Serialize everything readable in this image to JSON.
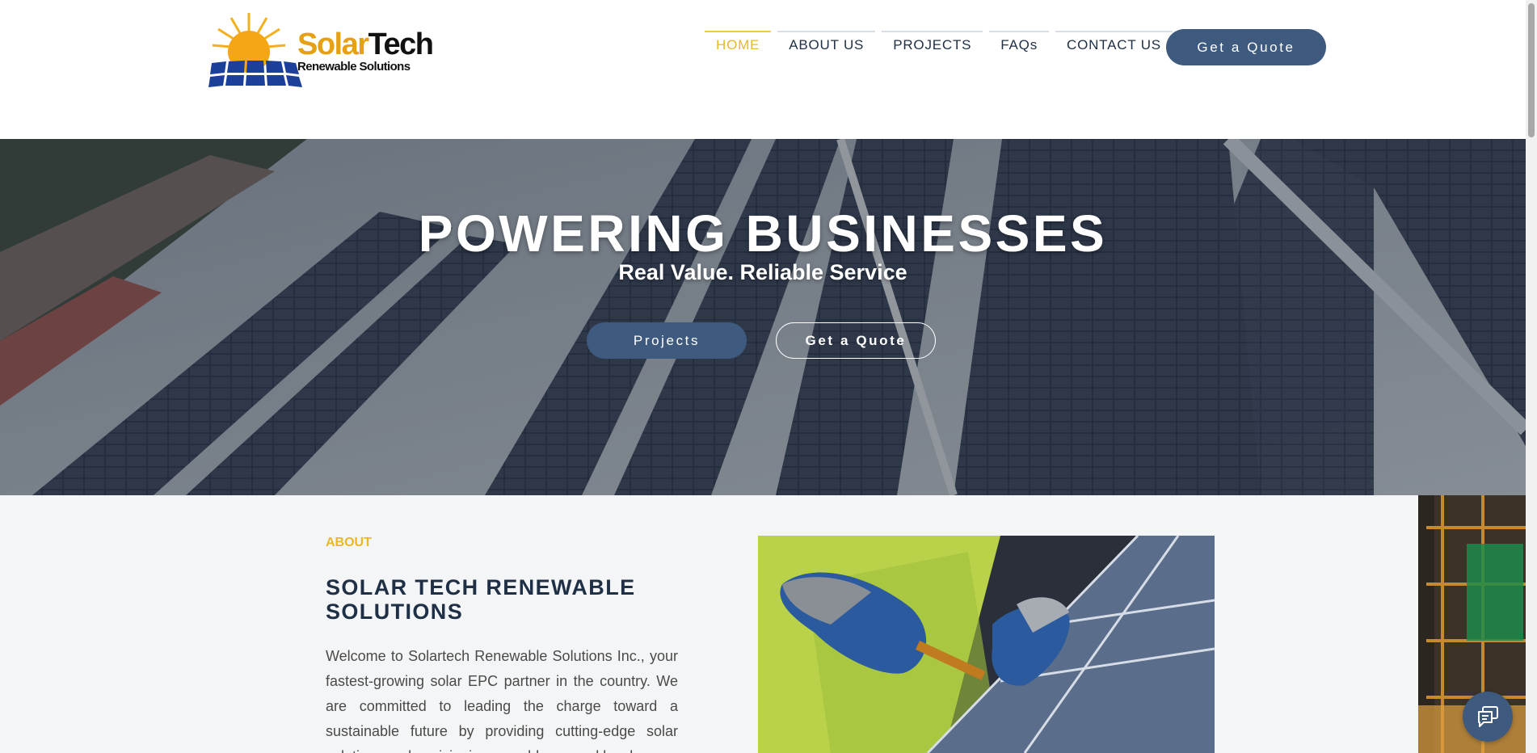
{
  "logo": {
    "word1": "Solar",
    "word2": "Tech",
    "tagline": "Renewable Solutions"
  },
  "nav": {
    "items": [
      {
        "label": "HOME",
        "active": true
      },
      {
        "label": "ABOUT US",
        "active": false
      },
      {
        "label": "PROJECTS",
        "active": false
      },
      {
        "label": "FAQs",
        "active": false
      },
      {
        "label": "CONTACT US",
        "active": false
      }
    ],
    "cta_label": "Get a Quote"
  },
  "hero": {
    "title": "POWERING BUSINESSES",
    "subtitle": "Real Value. Reliable Service",
    "primary_button": "Projects",
    "secondary_button": "Get a Quote"
  },
  "about": {
    "eyebrow": "ABOUT",
    "title": "SOLAR TECH RENEWABLE SOLUTIONS",
    "body": "Welcome to Solartech Renewable Solutions Inc., your fastest-growing solar EPC partner in the country. We are committed to leading the charge toward a sustainable future by providing cutting-edge solar solutions and envisioning a world powered by clean"
  },
  "colors": {
    "accent": "#e8b829",
    "navy": "#3e5a7e",
    "heading": "#1f2f45",
    "background": "#f4f5f6"
  },
  "icons": {
    "chat": "chat-icon"
  }
}
